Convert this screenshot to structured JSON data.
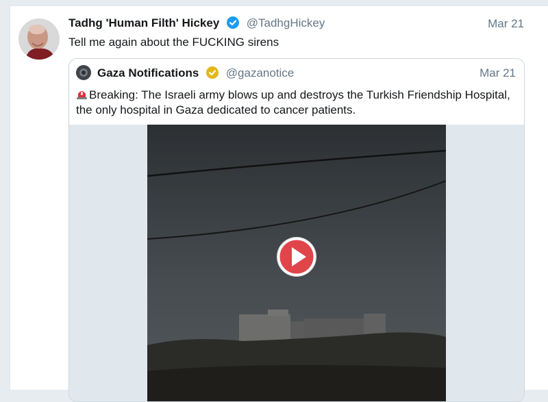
{
  "tweet": {
    "author_name": "Tadhg 'Human Filth' Hickey",
    "handle": "@TadhgHickey",
    "date": "Mar 21",
    "text": "Tell me again about the FUCKING sirens",
    "verified_badge_color": "#1d9bf0"
  },
  "quoted_tweet": {
    "author_name": "Gaza Notifications",
    "handle": "@gazanotice",
    "date": "Mar 21",
    "text": "Breaking: The Israeli army blows up and destroys the Turkish Friendship Hospital, the only hospital in Gaza dedicated to cancer patients.",
    "leading_emoji": "police-car-light-icon",
    "verified_badge_color": "#e2b719",
    "media": {
      "type": "video",
      "control": "play-icon",
      "play_button_color": "#e0454a"
    }
  }
}
